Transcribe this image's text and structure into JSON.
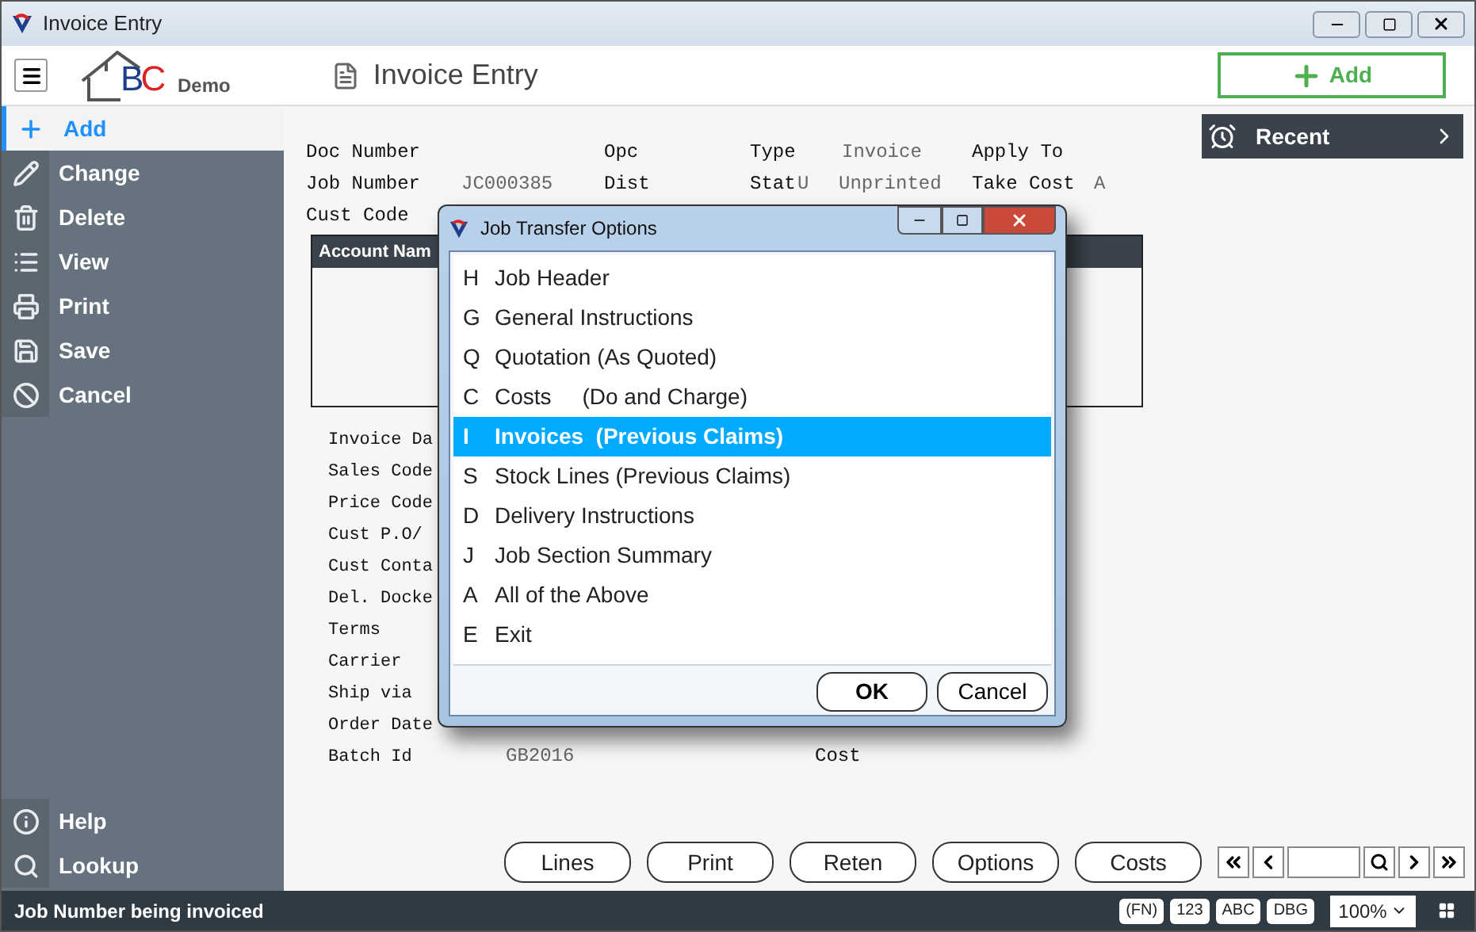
{
  "window": {
    "title": "Invoice Entry"
  },
  "header": {
    "logo_text": "BC",
    "brand": "Demo",
    "page_title": "Invoice Entry",
    "add_button": "Add"
  },
  "sidebar": {
    "items": [
      {
        "label": "Add",
        "selected": true
      },
      {
        "label": "Change",
        "selected": false
      },
      {
        "label": "Delete",
        "selected": false
      },
      {
        "label": "View",
        "selected": false
      },
      {
        "label": "Print",
        "selected": false
      },
      {
        "label": "Save",
        "selected": false
      },
      {
        "label": "Cancel",
        "selected": false
      }
    ],
    "bottom_items": [
      {
        "label": "Help"
      },
      {
        "label": "Lookup"
      }
    ]
  },
  "header_fields": [
    [
      {
        "label": "Doc Number"
      },
      {
        "label": "Opc"
      },
      {
        "label": "Type",
        "description": "Invoice"
      },
      {
        "label": "Apply To"
      }
    ],
    [
      {
        "label": "Job Number",
        "value": "JC000385"
      },
      {
        "label": "Dist"
      },
      {
        "label": "Stat",
        "value": "U",
        "description": "Unprinted"
      },
      {
        "label": "Take Cost",
        "value": "A"
      }
    ],
    [
      {
        "label": "Cust Code"
      }
    ]
  ],
  "account_table": {
    "columns": [
      "Account Nam"
    ]
  },
  "detail_fields": [
    {
      "label": "Invoice Da"
    },
    {
      "label": "Sales Code"
    },
    {
      "label": "Price Code"
    },
    {
      "label": "Cust P.O/"
    },
    {
      "label": "Cust Conta"
    },
    {
      "label": "Del. Docke"
    },
    {
      "label": "Terms"
    },
    {
      "label": "Carrier"
    },
    {
      "label": "Ship via"
    },
    {
      "label": "Order Date"
    },
    {
      "label": "Batch Id",
      "value": "GB2016",
      "label_2": "Cost"
    }
  ],
  "recent": {
    "label": "Recent"
  },
  "action_buttons": [
    "Lines",
    "Print",
    "Reten",
    "Options",
    "Costs"
  ],
  "dialog": {
    "title": "Job Transfer Options",
    "options": [
      {
        "key": "H",
        "label": "Job Header",
        "selected": false
      },
      {
        "key": "G",
        "label": "General Instructions",
        "selected": false
      },
      {
        "key": "Q",
        "label": "Quotation (As Quoted)",
        "selected": false
      },
      {
        "key": "C",
        "label": "Costs     (Do and Charge)",
        "selected": false
      },
      {
        "key": "I",
        "label": "Invoices  (Previous Claims)",
        "selected": true
      },
      {
        "key": "S",
        "label": "Stock Lines (Previous Claims)",
        "selected": false
      },
      {
        "key": "D",
        "label": "Delivery Instructions",
        "selected": false
      },
      {
        "key": "J",
        "label": "Job Section Summary",
        "selected": false
      },
      {
        "key": "A",
        "label": "All of the Above",
        "selected": false
      },
      {
        "key": "E",
        "label": "Exit",
        "selected": false
      }
    ],
    "buttons": [
      "OK",
      "Cancel"
    ]
  },
  "status_bar": {
    "message": "Job Number being invoiced",
    "indicators": [
      "(FN)",
      "123",
      "ABC",
      "DBG"
    ],
    "zoom": "100%"
  }
}
